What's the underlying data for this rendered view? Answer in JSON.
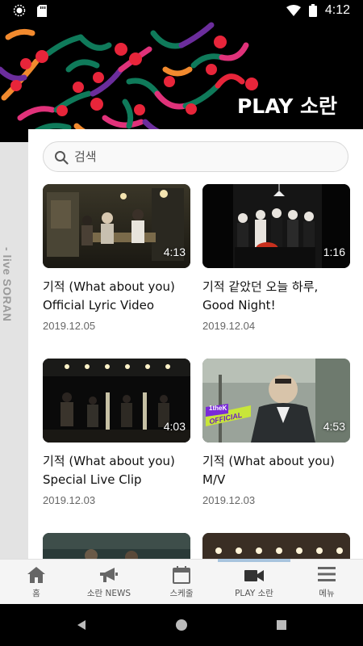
{
  "status_bar": {
    "time": "4:12"
  },
  "header": {
    "title": "PLAY 소란"
  },
  "side_rail": {
    "text": "- live SORAN"
  },
  "search": {
    "placeholder": "검색"
  },
  "videos": [
    {
      "title": "기적 (What about you) Official Lyric Video",
      "date": "2019.12.05",
      "duration": "4:13"
    },
    {
      "title": "기적 같았던 오늘 하루, Good Night!",
      "date": "2019.12.04",
      "duration": "1:16"
    },
    {
      "title": "기적 (What about you) Special Live Clip",
      "date": "2019.12.03",
      "duration": "4:03"
    },
    {
      "title": "기적 (What about you) M/V",
      "date": "2019.12.03",
      "duration": "4:53"
    }
  ],
  "thumb_badge": {
    "line1": "1theK",
    "line2": "OFFICIAL"
  },
  "bottom_nav": {
    "items": [
      {
        "label": "홈",
        "icon": "home-icon"
      },
      {
        "label": "소란 NEWS",
        "icon": "megaphone-icon"
      },
      {
        "label": "스케줄",
        "icon": "calendar-icon"
      },
      {
        "label": "PLAY 소란",
        "icon": "video-camera-icon"
      },
      {
        "label": "메뉴",
        "icon": "menu-icon"
      }
    ],
    "active": "PLAY 소란"
  },
  "colors": {
    "accent_red": "#e8253a",
    "accent_green": "#0f7a5a",
    "accent_purple": "#6b2d9c",
    "accent_orange": "#f28a2e",
    "accent_pink": "#e0327a",
    "nav_active": "#a8c4de"
  }
}
